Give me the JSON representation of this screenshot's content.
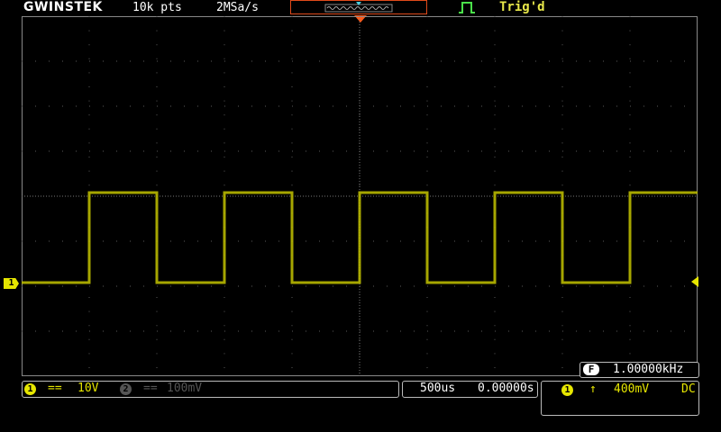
{
  "header": {
    "brand": "GWINSTEK",
    "record_length": "10k pts",
    "sample_rate": "2MSa/s",
    "trigger_status": "Trig'd"
  },
  "channel1": {
    "marker": "1",
    "coupling_symbol": "==",
    "scale": "10V",
    "color": "#e6e600"
  },
  "channel2": {
    "marker": "2",
    "coupling_symbol": "==",
    "scale": "100mV",
    "color": "#555555"
  },
  "timebase": {
    "scale": "500us",
    "position": "0.00000s"
  },
  "trigger": {
    "source": "1",
    "slope_symbol": "↑",
    "level": "400mV",
    "coupling": "DC"
  },
  "frequency_counter": {
    "badge": "F",
    "value": "1.00000kHz"
  },
  "waveform": {
    "type": "square",
    "frequency_khz": 1,
    "duty_cycle": 0.5,
    "high_divisions_above_ground": 2,
    "low_divisions_above_ground": 0,
    "first_rising_edge_div": 1,
    "colors": {
      "trace": "#b8b800",
      "grid": "#5a5a5a",
      "memory_window": "#e04a1a",
      "trigger_marker": "#ff5a1a"
    }
  }
}
